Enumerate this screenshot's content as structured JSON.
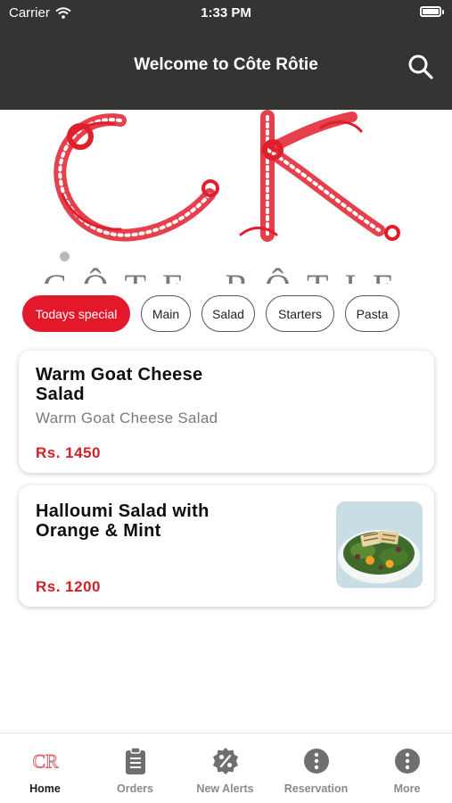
{
  "status_bar": {
    "carrier": "Carrier",
    "time": "1:33 PM"
  },
  "header": {
    "title": "Welcome to Côte Rôtie",
    "search_icon": "search-icon"
  },
  "banner": {
    "logo_letters": "CR",
    "subtitle": "CÔTE RÔTIE",
    "logo_color": "#e01f2c"
  },
  "categories": [
    {
      "label": "Todays special",
      "active": true
    },
    {
      "label": "Main",
      "active": false
    },
    {
      "label": "Salad",
      "active": false
    },
    {
      "label": "Starters",
      "active": false
    },
    {
      "label": "Pasta",
      "active": false
    }
  ],
  "menu_items": [
    {
      "name": "Warm Goat Cheese Salad",
      "description": "Warm Goat Cheese Salad",
      "price": "Rs. 1450",
      "has_image": false
    },
    {
      "name": "Halloumi Salad with Orange & Mint",
      "description": "",
      "price": "Rs. 1200",
      "has_image": true
    }
  ],
  "tab_bar": [
    {
      "label": "Home",
      "icon": "cr-logo-icon",
      "active": true
    },
    {
      "label": "Orders",
      "icon": "clipboard-icon",
      "active": false
    },
    {
      "label": "New Alerts",
      "icon": "percent-badge-icon",
      "active": false
    },
    {
      "label": "Reservation",
      "icon": "more-dots-icon",
      "active": false
    },
    {
      "label": "More",
      "icon": "more-dots-icon",
      "active": false
    }
  ],
  "colors": {
    "header_bg": "#343432",
    "accent": "#e3192b",
    "price": "#d02129"
  }
}
